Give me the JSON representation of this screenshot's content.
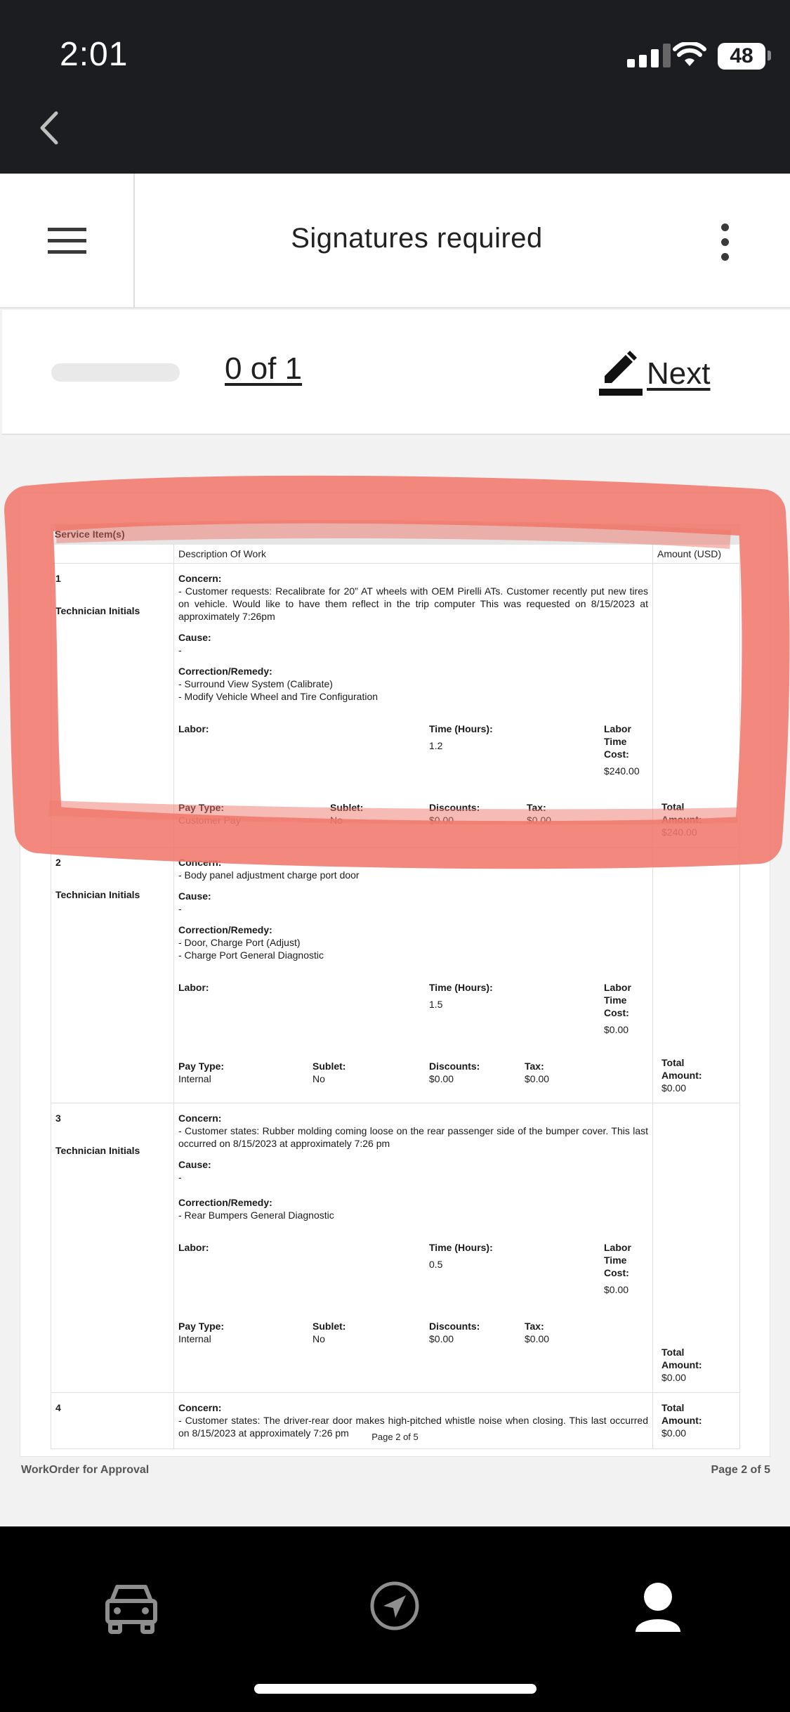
{
  "status_bar": {
    "time": "2:01",
    "battery": "48"
  },
  "header": {
    "title": "Signatures required"
  },
  "signature_bar": {
    "count_label": "0 of 1",
    "next_label": "Next"
  },
  "document": {
    "section_title": "Service Item(s)",
    "columns": {
      "description": "Description Of Work",
      "amount": "Amount (USD)"
    },
    "labels": {
      "technician_initials": "Technician Initials",
      "concern": "Concern:",
      "cause": "Cause:",
      "correction": "Correction/Remedy:",
      "labor": "Labor:",
      "time_hours": "Time (Hours):",
      "labor_time_cost": "Labor Time Cost:",
      "pay_type": "Pay Type:",
      "sublet": "Sublet:",
      "discounts": "Discounts:",
      "tax": "Tax:",
      "total_amount_1": "Total",
      "total_amount_2": "Amount:"
    },
    "items": [
      {
        "number": "1",
        "concern": "- Customer requests: Recalibrate for 20” AT wheels with OEM Pirelli ATs. Customer recently put new tires on vehicle. Would like to have them reflect in the trip computer This was requested on 8/15/2023 at approximately 7:26pm",
        "cause": "-",
        "correction_1": "- Surround View System (Calibrate)",
        "correction_2": "- Modify Vehicle Wheel and Tire Configuration",
        "time_hours": "1.2",
        "labor_time_cost": "$240.00",
        "pay_type": "Customer Pay",
        "sublet": "No",
        "discounts": "$0.00",
        "tax": "$0.00",
        "total": "$240.00"
      },
      {
        "number": "2",
        "concern": "- Body panel adjustment charge port door",
        "cause": "-",
        "correction_1": "- Door, Charge Port (Adjust)",
        "correction_2": "- Charge Port General Diagnostic",
        "time_hours": "1.5",
        "labor_time_cost": "$0.00",
        "pay_type": "Internal",
        "sublet": "No",
        "discounts": "$0.00",
        "tax": "$0.00",
        "total": "$0.00"
      },
      {
        "number": "3",
        "concern": "- Customer states: Rubber molding coming loose on the rear passenger side of the bumper cover. This last occurred on 8/15/2023 at approximately 7:26 pm",
        "cause": "-",
        "correction_1": "- Rear Bumpers General Diagnostic",
        "time_hours": "0.5",
        "labor_time_cost": "$0.00",
        "pay_type": "Internal",
        "sublet": "No",
        "discounts": "$0.00",
        "tax": "$0.00",
        "total": "$0.00"
      },
      {
        "number": "4",
        "concern": "- Customer states: The driver-rear door makes high-pitched whistle noise when closing. This last occurred on 8/15/2023 at approximately 7:26 pm",
        "total": "$0.00"
      }
    ],
    "page_footer": "Page 2 of 5",
    "footer_left": "WorkOrder for Approval",
    "footer_right": "Page 2 of 5"
  },
  "tabbar": {
    "icons": [
      "car-icon",
      "navigation-arrow-icon",
      "user-profile-icon"
    ],
    "active": "user-profile-icon"
  },
  "colors": {
    "highlight": "#f0786c",
    "dark": "#1c1d21"
  }
}
